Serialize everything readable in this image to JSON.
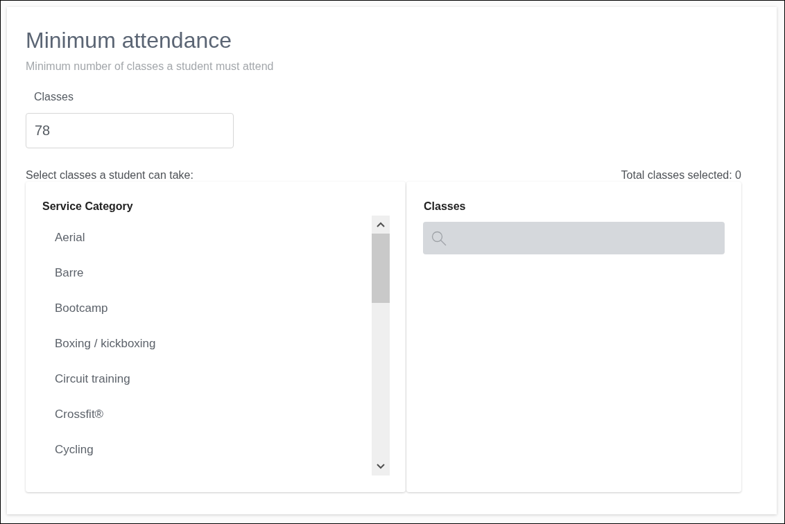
{
  "heading": {
    "title": "Minimum attendance",
    "subtitle": "Minimum number of classes a student must attend"
  },
  "classes_field": {
    "label": "Classes",
    "value": "78"
  },
  "selection": {
    "prompt": "Select classes a student can take:",
    "total": "Total classes selected: 0"
  },
  "service_category": {
    "title": "Service Category",
    "items": [
      {
        "label": "Aerial",
        "selected": false
      },
      {
        "label": "Barre",
        "selected": false
      },
      {
        "label": "Bootcamp",
        "selected": false
      },
      {
        "label": "Boxing / kickboxing",
        "selected": false
      },
      {
        "label": "Circuit training",
        "selected": false
      },
      {
        "label": "Crossfit®",
        "selected": false
      },
      {
        "label": "Cycling",
        "selected": false
      }
    ]
  },
  "classes_panel": {
    "title": "Classes"
  }
}
